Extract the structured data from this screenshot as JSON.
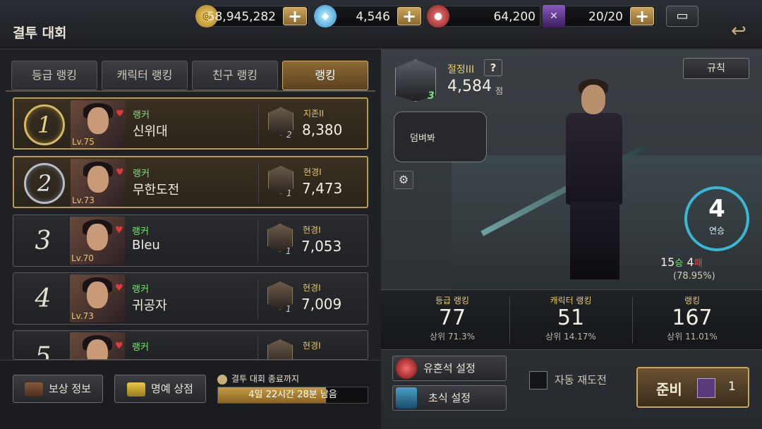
{
  "header": {
    "title": "결투 대회",
    "resources": [
      {
        "icon": "gold-coin-icon",
        "value": "58,945,282"
      },
      {
        "icon": "blue-gem-icon",
        "value": "4,546"
      },
      {
        "icon": "red-stone-icon",
        "value": "64,200"
      },
      {
        "icon": "ticket-icon",
        "value": "20/20"
      }
    ],
    "plus_label": "+"
  },
  "tabs": [
    {
      "label": "등급 랭킹",
      "active": false
    },
    {
      "label": "캐릭터 랭킹",
      "active": false
    },
    {
      "label": "친구 랭킹",
      "active": false
    },
    {
      "label": "랭킹",
      "active": true
    }
  ],
  "rankings": [
    {
      "rank": "1",
      "level": "Lv.75",
      "role": "랭커",
      "name": "신위대",
      "tier_num": "2",
      "tier": "지존II",
      "score": "8,380"
    },
    {
      "rank": "2",
      "level": "Lv.73",
      "role": "랭커",
      "name": "무한도전",
      "tier_num": "1",
      "tier": "현경I",
      "score": "7,473"
    },
    {
      "rank": "3",
      "level": "Lv.70",
      "role": "랭커",
      "name": "Bleu",
      "tier_num": "1",
      "tier": "현경I",
      "score": "7,053"
    },
    {
      "rank": "4",
      "level": "Lv.73",
      "role": "랭커",
      "name": "귀공자",
      "tier_num": "1",
      "tier": "현경I",
      "score": "7,009"
    },
    {
      "rank": "5",
      "level": "",
      "role": "랭커",
      "name": "",
      "tier_num": "",
      "tier": "현경I",
      "score": ""
    }
  ],
  "bottom_left": {
    "reward_info": "보상 정보",
    "honor_shop": "명예 상점",
    "end_label": "결투 대회 종료까지",
    "remaining": "4일 22시간 28분 남음",
    "progress": 0.72
  },
  "profile": {
    "tier": "절정III",
    "tier_num": "3",
    "help": "?",
    "score": "4,584",
    "score_unit": "점",
    "rules_button": "규칙",
    "speech": "덤벼봐",
    "win_streak": "4",
    "win_streak_label": "연승",
    "wins": "15",
    "wins_unit": "승",
    "losses": "4",
    "losses_unit": "패",
    "win_rate": "(78.95%)"
  },
  "stats": [
    {
      "label": "등급 랭킹",
      "value": "77",
      "pct": "상위 71.3%"
    },
    {
      "label": "캐릭터 랭킹",
      "value": "51",
      "pct": "상위 14.17%"
    },
    {
      "label": "랭킹",
      "value": "167",
      "pct": "상위 11.01%"
    }
  ],
  "bottom_right": {
    "soul_stone": "유혼석 설정",
    "technique": "초식 설정",
    "auto_retry": "자동 재도전",
    "ready": "준비",
    "ticket_count": "1"
  },
  "colors": {
    "accent_gold": "#c9a35a",
    "tier_text": "#e8c86a",
    "role_green": "#7ee07a",
    "streak_blue": "#39b8d6"
  }
}
